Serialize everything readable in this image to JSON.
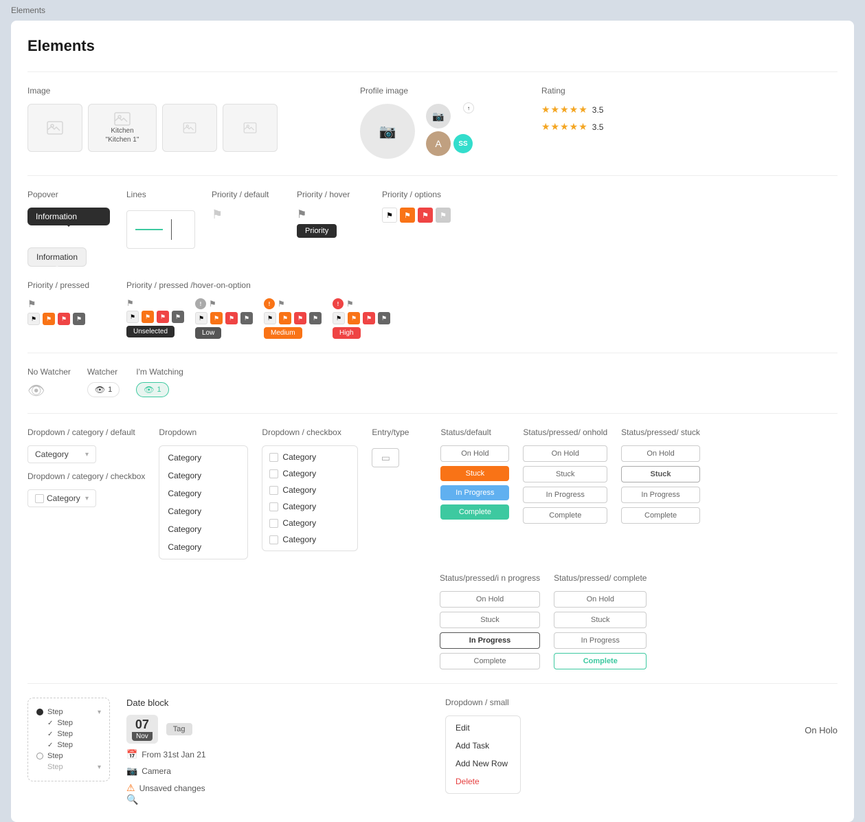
{
  "page": {
    "breadcrumb": "Elements",
    "title": "Elements"
  },
  "image_section": {
    "label": "Image",
    "thumbnails": [
      {
        "type": "blank",
        "label": ""
      },
      {
        "type": "labeled",
        "name": "Kitchen",
        "sublabel": "\"Kitchen 1\""
      },
      {
        "type": "blank2",
        "label": ""
      },
      {
        "type": "blank3",
        "label": ""
      }
    ]
  },
  "profile_section": {
    "label": "Profile image"
  },
  "rating_section": {
    "label": "Rating",
    "rows": [
      {
        "stars": 5,
        "value": "3.5"
      },
      {
        "stars": 5,
        "value": "3.5"
      }
    ]
  },
  "popover_section": {
    "label": "Popover",
    "dark_text": "Information",
    "light_text": "Information"
  },
  "lines_section": {
    "label": "Lines"
  },
  "priority_default": {
    "label": "Priority / default"
  },
  "priority_hover": {
    "label": "Priority / hover",
    "btn_label": "Priority"
  },
  "priority_options": {
    "label": "Priority / options"
  },
  "priority_pressed": {
    "label": "Priority / pressed"
  },
  "priority_pressed_hover": {
    "label": "Priority / pressed /hover-on-option",
    "states": [
      {
        "btn": "Unselected"
      },
      {
        "btn": "Low"
      },
      {
        "btn": "Medium"
      },
      {
        "btn": "High"
      }
    ]
  },
  "watcher": {
    "no_watcher_label": "No Watcher",
    "watcher_label": "Watcher",
    "watching_label": "I'm Watching",
    "watcher_count": "1",
    "watching_count": "1"
  },
  "dropdown_category": {
    "label": "Dropdown / category / default",
    "placeholder": "Category"
  },
  "dropdown_category_checkbox": {
    "label": "Dropdown / category / checkbox",
    "placeholder": "Category"
  },
  "dropdown": {
    "label": "Dropdown",
    "items": [
      "Category",
      "Category",
      "Category",
      "Category",
      "Category",
      "Category"
    ]
  },
  "dropdown_checkbox": {
    "label": "Dropdown / checkbox",
    "items": [
      "Category",
      "Category",
      "Category",
      "Category",
      "Category",
      "Category"
    ]
  },
  "entry_type": {
    "label": "Entry/type"
  },
  "status_default": {
    "label": "Status/default",
    "states": [
      "On Hold",
      "Stuck",
      "In Progress",
      "Complete"
    ]
  },
  "status_pressed_onhold": {
    "label": "Status/pressed/ onhold",
    "states": [
      "On Hold",
      "Stuck",
      "In Progress",
      "Complete"
    ]
  },
  "status_pressed_stuck": {
    "label": "Status/pressed/ stuck",
    "states": [
      "On Hold",
      "Stuck",
      "In Progress",
      "Complete"
    ]
  },
  "status_pressed_inprogress": {
    "label": "Status/pressed/i n progress",
    "states": [
      "On Hold",
      "Stuck",
      "In Progress",
      "Complete"
    ]
  },
  "status_pressed_complete": {
    "label": "Status/pressed/ complete",
    "states": [
      "On Hold",
      "Stuck",
      "In Progress",
      "Complete"
    ]
  },
  "dropdown_small": {
    "label": "Dropdown / small",
    "items": [
      "Edit",
      "Add Task",
      "Add New Row",
      "Delete"
    ]
  },
  "date_block": {
    "label": "Date block",
    "date": "07",
    "month": "Nov",
    "tag": "Tag",
    "from_label": "From 31st Jan 21",
    "camera_label": "Camera",
    "unsaved_label": "Unsaved changes"
  },
  "step_panel": {
    "steps": [
      {
        "type": "filled",
        "text": "Step",
        "checked": true
      },
      {
        "type": "sub",
        "text": "Step",
        "checked": true
      },
      {
        "type": "sub",
        "text": "Step",
        "checked": true
      },
      {
        "type": "sub",
        "text": "Step",
        "checked": true
      },
      {
        "type": "empty",
        "text": "Step",
        "checked": false
      },
      {
        "type": "sub",
        "text": "Step",
        "checked": false
      }
    ]
  },
  "on_holo_text": "On Holo"
}
